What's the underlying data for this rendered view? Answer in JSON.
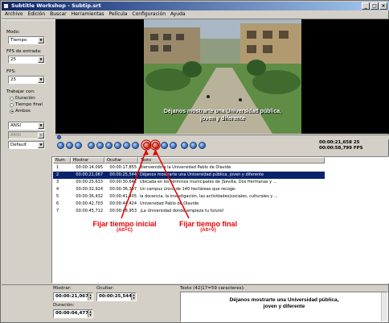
{
  "window": {
    "title": "Subtitle Workshop - Subtip.srt"
  },
  "menu": [
    "Archivo",
    "Edición",
    "Buscar",
    "Herramientas",
    "Película",
    "Configuración",
    "Ayuda"
  ],
  "left": {
    "modo_label": "Modo:",
    "modo_value": "Tiempo",
    "fps_entrada_label": "FPS de entrada:",
    "fps_entrada_value": "25",
    "fps_label": "FPS:",
    "fps_value": "25",
    "trabajar_label": "Trabajar con:",
    "radio_duracion": "Duración",
    "radio_tiempo_final": "Tiempo final",
    "radio_ambos": "Ambos",
    "charset1": "ANSI",
    "charset2": "ANSI",
    "format": "Default"
  },
  "video": {
    "subtitle_line1": "Déjanos mostrarte una Universidad pública,",
    "subtitle_line2": "joven y diferente"
  },
  "player": {
    "time_current": "00:00:21,658",
    "time_total": "00:00:58,799",
    "fps_a": "25",
    "fps_b": "FPS"
  },
  "table": {
    "headers": [
      "Num",
      "Mostrar",
      "Ocultar",
      "Texto"
    ],
    "rows": [
      {
        "num": "1",
        "show": "00:00:14,095",
        "hide": "00:00:17,855",
        "text": "Bienvenido a la Universidad Pablo de Olavide"
      },
      {
        "num": "2",
        "show": "00:00:21,067",
        "hide": "00:00:25,544",
        "text": "Déjanos mostrarte una Universidad pública, joven y diferente"
      },
      {
        "num": "3",
        "show": "00:00:25,633",
        "hide": "00:00:30,642",
        "text": "Ubicada en los términos municipales de |Sevilla, Dos Hermanas y ..."
      },
      {
        "num": "4",
        "show": "00:00:32,924",
        "hide": "00:00:36,397",
        "text": "Un campus único de 140 hectáreas que recoge:"
      },
      {
        "num": "5",
        "show": "00:00:36,432",
        "hide": "00:00:41,405",
        "text": "la docencia, la investigación, las actividades|sociales, culturales y ..."
      },
      {
        "num": "6",
        "show": "00:00:42,703",
        "hide": "00:00:44,424",
        "text": "Universidad Pablo de Olavide"
      },
      {
        "num": "7",
        "show": "00:00:45,712",
        "hide": "00:00:48,953",
        "text": "¡La Universidad donde empieza tu futuro!"
      }
    ]
  },
  "annotations": {
    "start_title": "Fijar tiempo inicial",
    "start_shortcut": "(Alt+C)",
    "end_title": "Fijar tiempo final",
    "end_shortcut": "(Alt+V)"
  },
  "editor": {
    "mostrar_label": "Mostrar:",
    "mostrar_value": "00:00:21,067",
    "ocultar_label": "Ocultar:",
    "ocultar_value": "00:00:25,544",
    "duracion_label": "Duración:",
    "duracion_value": "00:00:04,477",
    "texto_label": "Texto (42|17=59 caracteres):",
    "texto_line1": "Déjanos mostrarte una Universidad pública,",
    "texto_line2": "joven y diferente"
  },
  "colors": {
    "selection": "#0a246a",
    "annotation": "#e60000",
    "titlebar": "#0a246a"
  }
}
